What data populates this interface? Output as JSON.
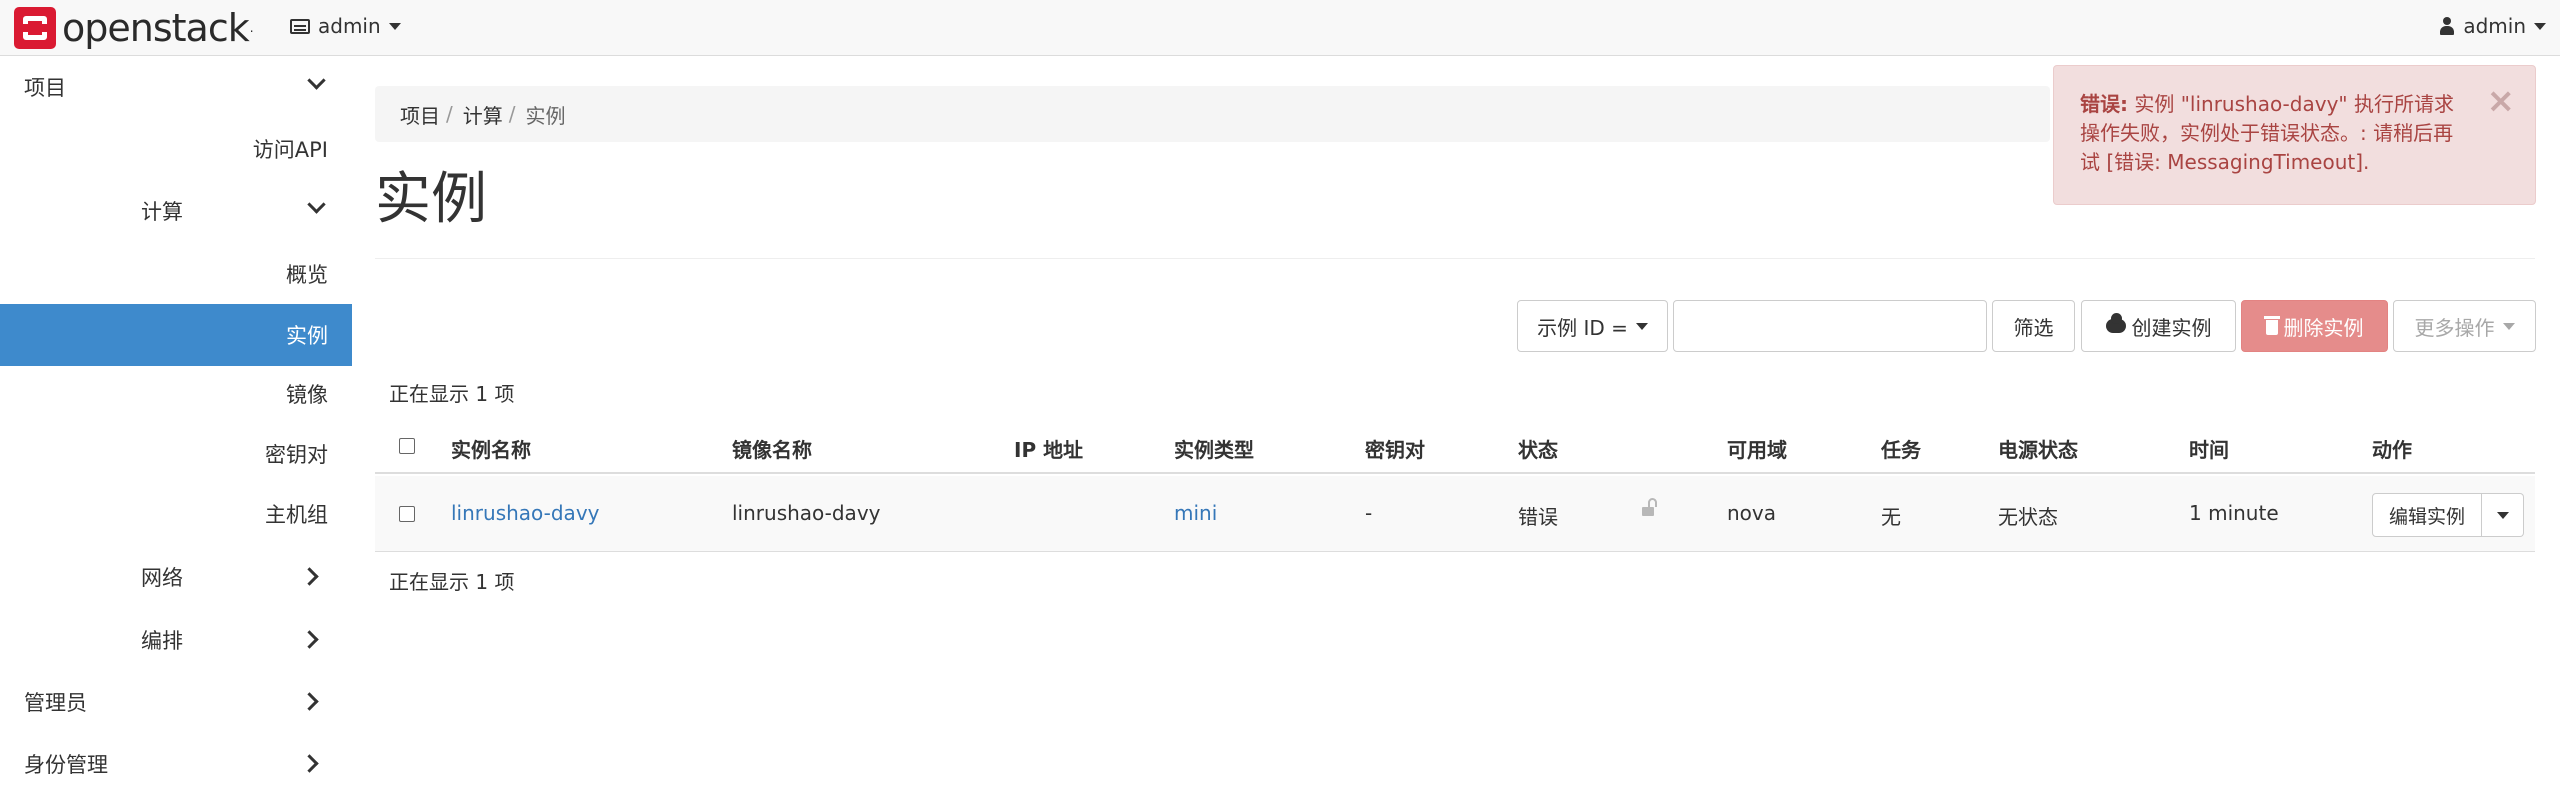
{
  "header": {
    "brand_text": "openstack",
    "brand_tm": ".",
    "project_selector": "admin",
    "user_menu": "admin"
  },
  "sidebar": {
    "project": "项目",
    "api_access": "访问API",
    "compute": "计算",
    "overview": "概览",
    "instances": "实例",
    "images": "镜像",
    "keypairs": "密钥对",
    "server_groups": "主机组",
    "network": "网络",
    "orchestration": "编排",
    "admin": "管理员",
    "identity": "身份管理"
  },
  "breadcrumb": [
    "项目",
    "计算",
    "实例"
  ],
  "breadcrumb_sep": "/",
  "page_title": "实例",
  "toolbar": {
    "filter_select": "示例 ID =",
    "filter_input_value": "",
    "filter_button": "筛选",
    "create_button": "创建实例",
    "delete_button": "删除实例",
    "more_actions": "更多操作"
  },
  "count_text": "正在显示 1 项",
  "table": {
    "columns": [
      "实例名称",
      "镜像名称",
      "IP 地址",
      "实例类型",
      "密钥对",
      "状态",
      "可用域",
      "任务",
      "电源状态",
      "时间",
      "动作"
    ],
    "rows": [
      {
        "name": "linrushao-davy",
        "image": "linrushao-davy",
        "ip": "",
        "flavor": "mini",
        "keypair": "-",
        "status": "错误",
        "az": "nova",
        "task": "无",
        "power": "无状态",
        "time": "1 minute",
        "action": "编辑实例"
      }
    ]
  },
  "alert": {
    "title": "错误:",
    "message": "实例 \"linrushao-davy\" 执行所请求操作失败，实例处于错误状态。: 请稍后再试 [错误: MessagingTimeout].",
    "close": "×",
    "color": "#a94442",
    "background": "#f2dede"
  },
  "colors": {
    "active_nav": "#3e8acc",
    "link": "#3577b8",
    "danger_button": "#e58c8b",
    "brand_red": "#da1a32"
  }
}
